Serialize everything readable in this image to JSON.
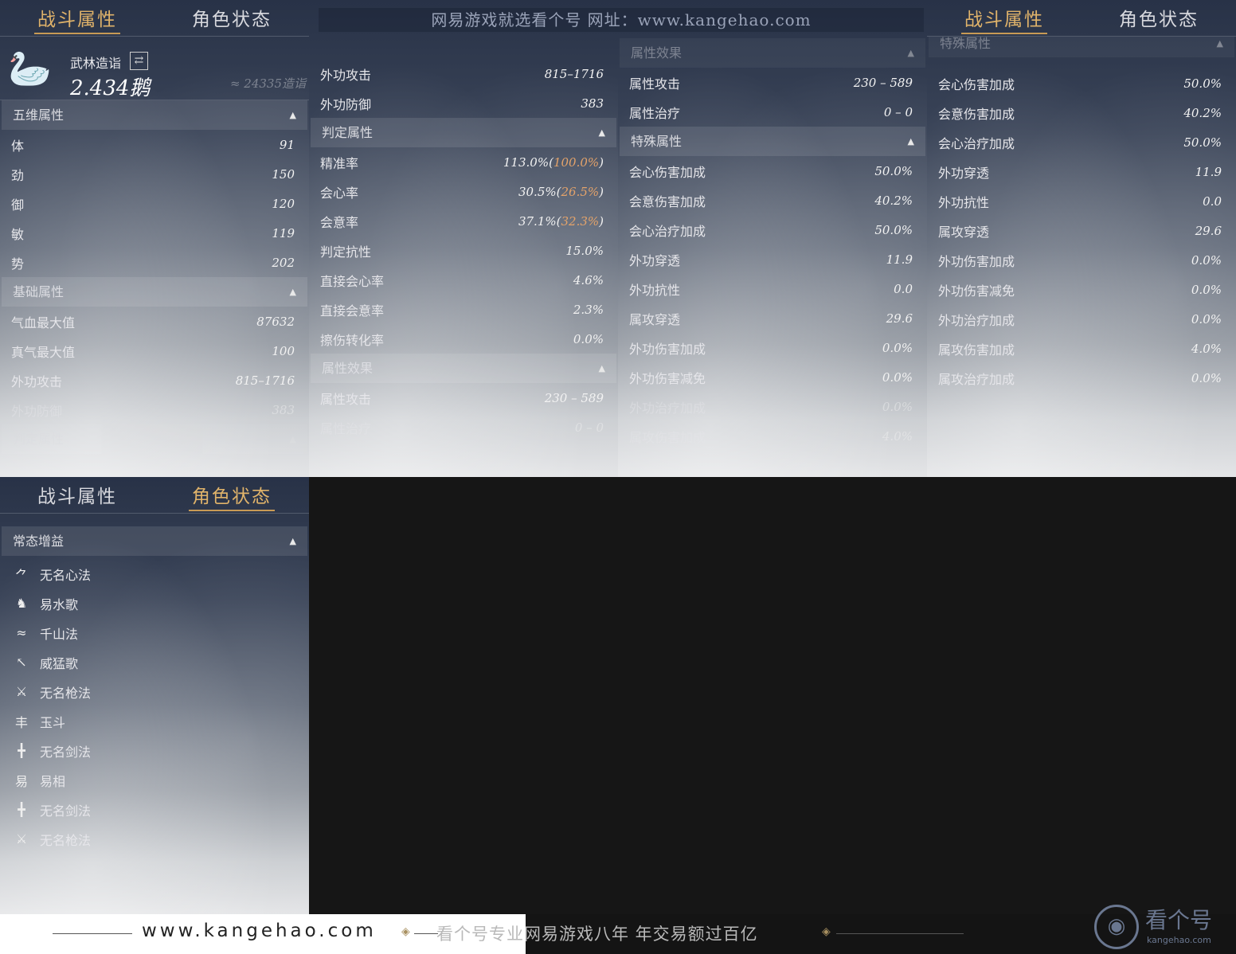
{
  "tabs": {
    "combat": "战斗属性",
    "status": "角色状态"
  },
  "profile": {
    "title": "武林造诣",
    "value": "2.434鹅",
    "equiv": "≈ 24335造诣"
  },
  "p1": {
    "sec_wuwei": "五维属性",
    "wuwei": [
      {
        "k": "体",
        "v": "91"
      },
      {
        "k": "劲",
        "v": "150"
      },
      {
        "k": "御",
        "v": "120"
      },
      {
        "k": "敏",
        "v": "119"
      },
      {
        "k": "势",
        "v": "202"
      }
    ],
    "sec_base": "基础属性",
    "base": [
      {
        "k": "气血最大值",
        "v": "87632"
      },
      {
        "k": "真气最大值",
        "v": "100"
      },
      {
        "k": "外功攻击",
        "v": "815–1716"
      },
      {
        "k": "外功防御",
        "v": "383"
      }
    ],
    "sec_judge": "判定属性"
  },
  "p2": {
    "top": [
      {
        "k": "外功攻击",
        "v": "815–1716"
      },
      {
        "k": "外功防御",
        "v": "383"
      }
    ],
    "sec_judge": "判定属性",
    "judge": [
      {
        "k": "精准率",
        "v": "113.0%(",
        "h": "100.0%",
        ")": ")"
      },
      {
        "k": "会心率",
        "v": "30.5%(",
        "h": "26.5%",
        ")": ")"
      },
      {
        "k": "会意率",
        "v": "37.1%(",
        "h": "32.3%",
        ")": ")"
      }
    ],
    "judge2": [
      {
        "k": "判定抗性",
        "v": "15.0%"
      },
      {
        "k": "直接会心率",
        "v": "4.6%"
      },
      {
        "k": "直接会意率",
        "v": "2.3%"
      },
      {
        "k": "擦伤转化率",
        "v": "0.0%"
      }
    ],
    "sec_attr": "属性效果",
    "attr": [
      {
        "k": "属性攻击",
        "v": "230 – 589"
      },
      {
        "k": "属性治疗",
        "v": "0 – 0"
      }
    ]
  },
  "p3": {
    "sec_attr": "属性效果",
    "attr": [
      {
        "k": "属性攻击",
        "v": "230 – 589"
      },
      {
        "k": "属性治疗",
        "v": "0 – 0"
      }
    ],
    "sec_special": "特殊属性",
    "special": [
      {
        "k": "会心伤害加成",
        "v": "50.0%"
      },
      {
        "k": "会意伤害加成",
        "v": "40.2%"
      },
      {
        "k": "会心治疗加成",
        "v": "50.0%"
      },
      {
        "k": "外功穿透",
        "v": "11.9"
      },
      {
        "k": "外功抗性",
        "v": "0.0"
      },
      {
        "k": "属攻穿透",
        "v": "29.6"
      },
      {
        "k": "外功伤害加成",
        "v": "0.0%"
      },
      {
        "k": "外功伤害减免",
        "v": "0.0%"
      },
      {
        "k": "外功治疗加成",
        "v": "0.0%"
      },
      {
        "k": "属攻伤害加成",
        "v": "4.0%"
      }
    ]
  },
  "p4": {
    "sec_special": "特殊属性",
    "special": [
      {
        "k": "会心伤害加成",
        "v": "50.0%"
      },
      {
        "k": "会意伤害加成",
        "v": "40.2%"
      },
      {
        "k": "会心治疗加成",
        "v": "50.0%"
      },
      {
        "k": "外功穿透",
        "v": "11.9"
      },
      {
        "k": "外功抗性",
        "v": "0.0"
      },
      {
        "k": "属攻穿透",
        "v": "29.6"
      },
      {
        "k": "外功伤害加成",
        "v": "0.0%"
      },
      {
        "k": "外功伤害减免",
        "v": "0.0%"
      },
      {
        "k": "外功治疗加成",
        "v": "0.0%"
      },
      {
        "k": "属攻伤害加成",
        "v": "4.0%"
      },
      {
        "k": "属攻治疗加成",
        "v": "0.0%"
      }
    ]
  },
  "p5": {
    "sec_buff": "常态增益",
    "buffs": [
      {
        "icon": "⺈",
        "name": "无名心法"
      },
      {
        "icon": "♞",
        "name": "易水歌"
      },
      {
        "icon": "≈",
        "name": "千山法"
      },
      {
        "icon": "↖",
        "name": "威猛歌"
      },
      {
        "icon": "⚔",
        "name": "无名枪法"
      },
      {
        "icon": "丰",
        "name": "玉斗"
      },
      {
        "icon": "╋",
        "name": "无名剑法"
      },
      {
        "icon": "易",
        "name": "易相"
      },
      {
        "icon": "╋",
        "name": "无名剑法"
      },
      {
        "icon": "⚔",
        "name": "无名枪法"
      }
    ]
  },
  "watermark": "网易游戏就选看个号   网址：www.kangehao.com",
  "footer": {
    "url": "www.kangehao.com",
    "slogan": "看个号专业网易游戏八年   年交易额过百亿",
    "logo": "看个号",
    "logo_sub": "kangehao.com",
    "logo_icon": "◉"
  }
}
